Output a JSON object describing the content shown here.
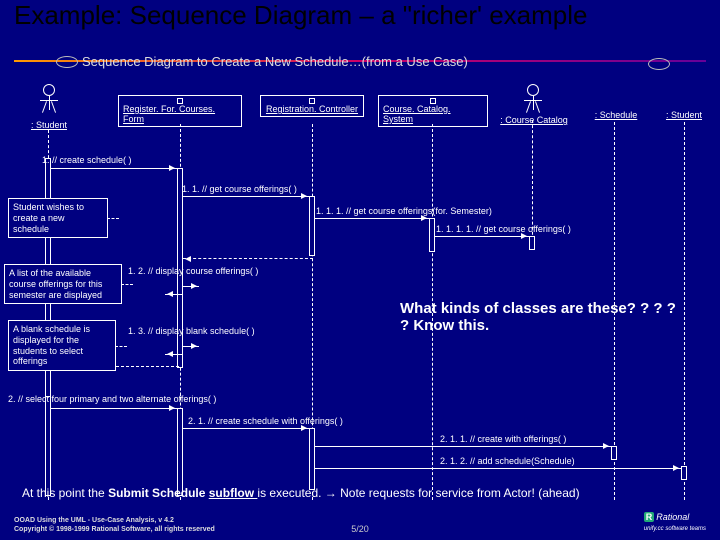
{
  "title": "Example: Sequence Diagram – a \"richer' example",
  "usecase": "Sequence Diagram to Create a New Schedule…(from a Use Case)",
  "lifelines": {
    "student_actor": ": Student",
    "form": "Register. For. Courses. Form",
    "controller": "Registration. Controller",
    "catalog_sys": "Course. Catalog. System",
    "course_catalog": ": Course Catalog",
    "schedule": ": Schedule",
    "student_obj": ": Student"
  },
  "messages": {
    "m1": "1. // create schedule( )",
    "m1_1": "1. 1. // get course offerings( )",
    "m1_1_1": "1. 1. 1. // get course offerings(for. Semester)",
    "m1_1_1_1": "1. 1. 1. 1. // get course offerings( )",
    "m1_2": "1. 2. // display course offerings( )",
    "m1_3": "1. 3. // display blank schedule( )",
    "m2": "2. // select four primary and two alternate offerings( )",
    "m2_1": "2. 1. // create schedule with offerings( )",
    "m2_1_1": "2. 1. 1. // create with offerings( )",
    "m2_1_2": "2. 1. 2. // add schedule(Schedule)"
  },
  "notes": {
    "n1": "Student wishes to create a new schedule",
    "n2": "A list of the available course offerings for this semester are displayed",
    "n3": "A blank schedule is displayed for the students to select offerings"
  },
  "callout": "What kinds of classes are these? ? ? ? ? Know this.",
  "endnote_pre": "At this point the ",
  "endnote_bold1": "Submit Schedule ",
  "endnote_bold2": "subflow ",
  "endnote_post": "is executed. → Note requests for service from Actor!  (ahead)",
  "footer_l1": "OOAD Using the UML - Use-Case Analysis, v 4.2",
  "footer_l2": "Copyright © 1998-1999 Rational Software, all rights reserved",
  "page": "5/20",
  "logo_text": "Rational",
  "logo_tag": "unify.cc software teams"
}
